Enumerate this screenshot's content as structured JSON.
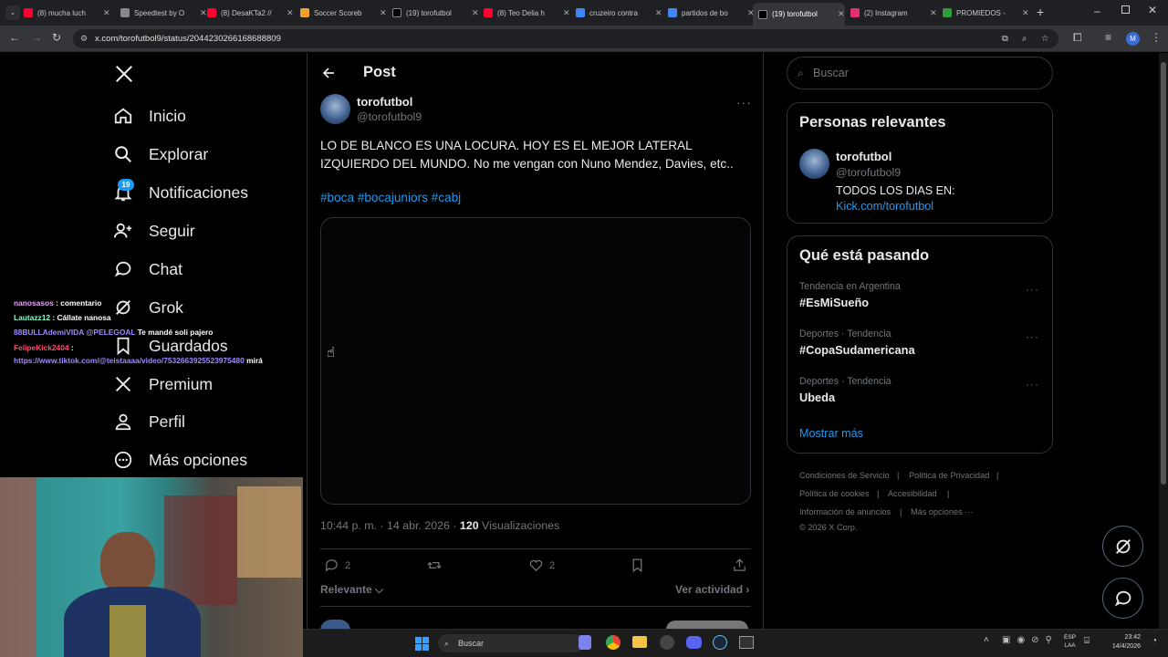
{
  "browser": {
    "tabs": [
      {
        "label": "(8) mucha luch",
        "favicon": "youtube",
        "color": "#ff0033"
      },
      {
        "label": "Speedtest by O",
        "favicon": "speedtest",
        "color": "#888888"
      },
      {
        "label": "(8) DesaKTa2 //",
        "favicon": "youtube",
        "color": "#ff0033"
      },
      {
        "label": "Soccer Scoreb",
        "favicon": "soccer",
        "color": "#f0a030"
      },
      {
        "label": "(19) torofutbol",
        "favicon": "x",
        "color": "#000000"
      },
      {
        "label": "(8) Teo Delia h",
        "favicon": "youtube",
        "color": "#ff0033"
      },
      {
        "label": "cruzeiro contra",
        "favicon": "google",
        "color": "#4285f4"
      },
      {
        "label": "partidos de bo",
        "favicon": "google",
        "color": "#4285f4"
      },
      {
        "label": "(19) torofutbol",
        "favicon": "x",
        "color": "#000000",
        "active": true
      },
      {
        "label": "(2) Instagram",
        "favicon": "instagram",
        "color": "#e1306c"
      },
      {
        "label": "PROMIEDOS -",
        "favicon": "promiedos",
        "color": "#2e9d3a"
      }
    ],
    "url": "x.com/torofutbol9/status/2044230266168688809"
  },
  "nav": {
    "items": [
      {
        "label": "Inicio",
        "icon": "home-icon"
      },
      {
        "label": "Explorar",
        "icon": "search-icon"
      },
      {
        "label": "Notificaciones",
        "icon": "bell-icon"
      },
      {
        "label": "Seguir",
        "icon": "person-add-icon"
      },
      {
        "label": "Chat",
        "icon": "chat-icon"
      },
      {
        "label": "Grok",
        "icon": "grok-icon"
      },
      {
        "label": "Guardados",
        "icon": "bookmark-icon"
      },
      {
        "label": "Premium",
        "icon": "x-logo-icon"
      },
      {
        "label": "Perfil",
        "icon": "person-icon"
      },
      {
        "label": "Más opciones",
        "icon": "more-circle-icon"
      }
    ],
    "notifications_badge": "19"
  },
  "stream_chat": [
    {
      "user": "nanosasos",
      "user_color": "#e8a0ff",
      "message": ": comentario"
    },
    {
      "user": "Lautazz12",
      "user_color": "#7fffd4",
      "message": ": Cállate nanosa"
    },
    {
      "user": "88BULLAdemiVIDA",
      "user_color": "#9b8bff",
      "message": "@PELEGOAL",
      "extra": "Te mandé soli pajero"
    },
    {
      "user": "FelipeKick2404",
      "user_color": "#ff4d6d",
      "message": ":"
    },
    {
      "user": "",
      "user_color": "#9b8bff",
      "message": "https://www.tiktok.com/@teistaaaa/video/7532663925523975480",
      "extra": "mirá"
    }
  ],
  "post": {
    "header_title": "Post",
    "author_name": "torofutbol",
    "author_handle": "@torofutbol9",
    "text": "LO DE BLANCO  ES UNA LOCURA. HOY ES EL MEJOR LATERAL IZQUIERDO DEL MUNDO. No me vengan con Nuno Mendez, Davies, etc..",
    "hashtags": "#boca #bocajuniors #cabj",
    "time": "10:44 p. m. · 14 abr. 2026 · ",
    "views_count": "120",
    "views_label": " Visualizaciones",
    "replies": "2",
    "reposts": "",
    "likes": "2",
    "sort_label": "Relevante",
    "activity_label": "Ver actividad"
  },
  "sidebar": {
    "search_placeholder": "Buscar",
    "relevant_title": "Personas relevantes",
    "relevant_name": "torofutbol",
    "relevant_handle": "@torofutbol9",
    "relevant_bio": "TODOS LOS DIAS EN:",
    "relevant_link": "Kick.com/torofutbol",
    "trends_title": "Qué está pasando",
    "trends": [
      {
        "context": "Tendencia en Argentina",
        "name": "#EsMiSueño"
      },
      {
        "context": "Deportes · Tendencia",
        "name": "#CopaSudamericana"
      },
      {
        "context": "Deportes · Tendencia",
        "name": "Ubeda"
      }
    ],
    "show_more": "Mostrar más",
    "footer": {
      "terms": "Condiciones de Servicio",
      "privacy": "Política de Privacidad",
      "cookies": "Política de cookies",
      "accessibility": "Accesibilidad",
      "ads": "Información de anuncios",
      "more": "Más opciones ···",
      "copyright": "© 2026 X Corp."
    }
  },
  "taskbar": {
    "search_label": "Buscar",
    "lang_top": "ESP",
    "lang_bottom": "LAA",
    "time": "23:42",
    "date": "14/4/2026"
  },
  "colors": {
    "accent": "#1d9bf0",
    "text": "#e7e9ea",
    "muted": "#71767b",
    "border": "#2f3336"
  }
}
